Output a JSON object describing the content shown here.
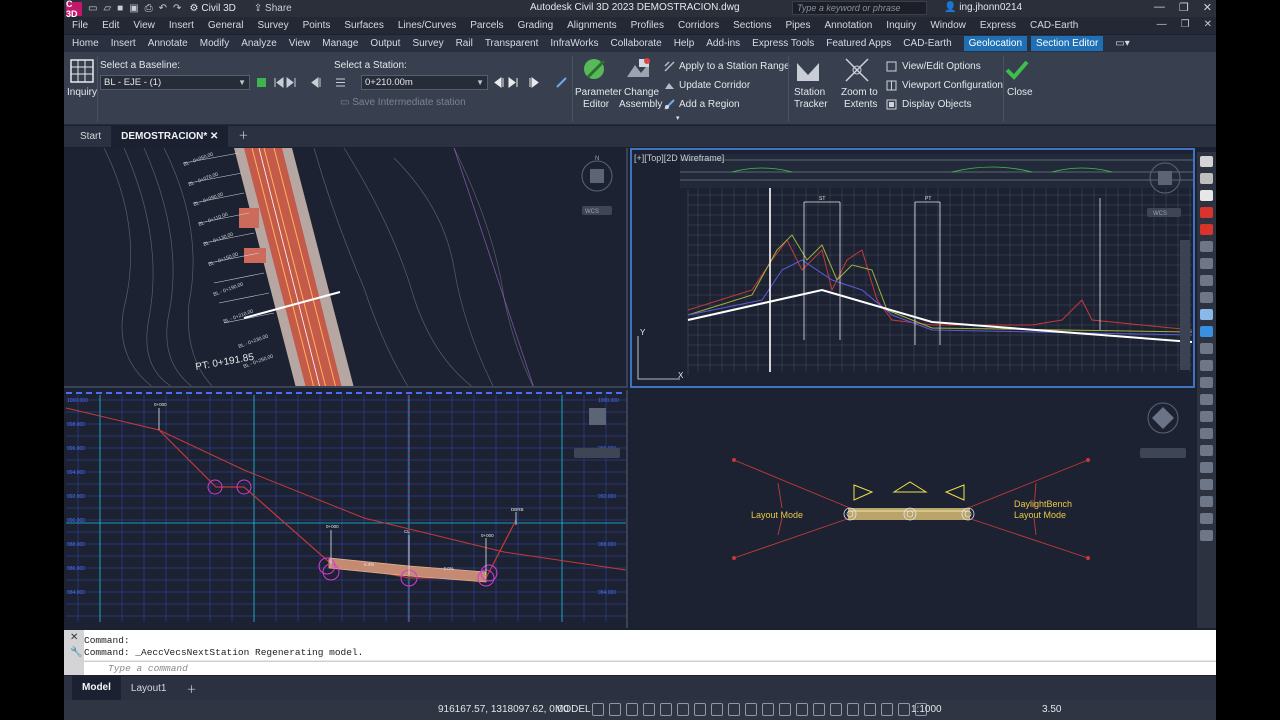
{
  "titlebar": {
    "workspace": "Civil 3D",
    "share": "Share",
    "title": "Autodesk Civil 3D 2023    DEMOSTRACION.dwg",
    "search_placeholder": "Type a keyword or phrase",
    "user": "ing.jhonn0214",
    "logo": "C 3D"
  },
  "menubar": [
    "File",
    "Edit",
    "View",
    "Insert",
    "General",
    "Survey",
    "Points",
    "Surfaces",
    "Lines/Curves",
    "Parcels",
    "Grading",
    "Alignments",
    "Profiles",
    "Corridors",
    "Sections",
    "Pipes",
    "Annotation",
    "Inquiry",
    "Window",
    "Express",
    "CAD-Earth"
  ],
  "ribbon_tabs": [
    "Home",
    "Insert",
    "Annotate",
    "Modify",
    "Analyze",
    "View",
    "Manage",
    "Output",
    "Survey",
    "Rail",
    "Transparent",
    "InfraWorks",
    "Collaborate",
    "Help",
    "Add-ins",
    "Express Tools",
    "Featured Apps",
    "CAD-Earth"
  ],
  "ribbon_active_tabs": [
    "Geolocation",
    "Section Editor"
  ],
  "ribbon": {
    "inquiry": "Inquiry",
    "baseline_label": "Select a Baseline:",
    "baseline_value": "BL - EJE - (1)",
    "station_label": "Select a Station:",
    "station_value": "0+210.00m",
    "save_intermediate": "Save Intermediate station",
    "parameter_editor_1": "Parameter",
    "parameter_editor_2": "Editor",
    "change_assembly_1": "Change",
    "change_assembly_2": "Assembly",
    "apply_station_range": "Apply to a Station Range",
    "update_corridor": "Update Corridor",
    "add_region": "Add a Region",
    "station_tracker_1": "Station",
    "station_tracker_2": "Tracker",
    "zoom_extents_1": "Zoom to",
    "zoom_extents_2": "Extents",
    "view_edit_options": "View/Edit Options",
    "viewport_configuration": "Viewport Configuration",
    "display_objects": "Display Objects",
    "close": "Close"
  },
  "doc_tabs": {
    "start": "Start",
    "current": "DEMOSTRACION*"
  },
  "viewports": {
    "top_right_label": "[+][Top][2D Wireframe]",
    "layout_mode_left": "Layout  Mode",
    "daylight_1": "DaylightBench",
    "daylight_2": "Layout  Mode",
    "pt_label": "PT: 0+191.85",
    "wcs": "WCS"
  },
  "command": {
    "line1": "Command:",
    "line2": "Command:  _AeccVecsNextStation Regenerating model.",
    "placeholder": "Type a command"
  },
  "layout_tabs": [
    "Model",
    "Layout1"
  ],
  "statusbar": {
    "coords": "916167.57, 1318097.62, 0.00",
    "model": "MODEL",
    "scale": "1:1000",
    "value": "3.50"
  },
  "colors": {
    "accent": "#1f6fb5",
    "grid_bg": "#1b2130",
    "magenta": "#d43bd4"
  }
}
